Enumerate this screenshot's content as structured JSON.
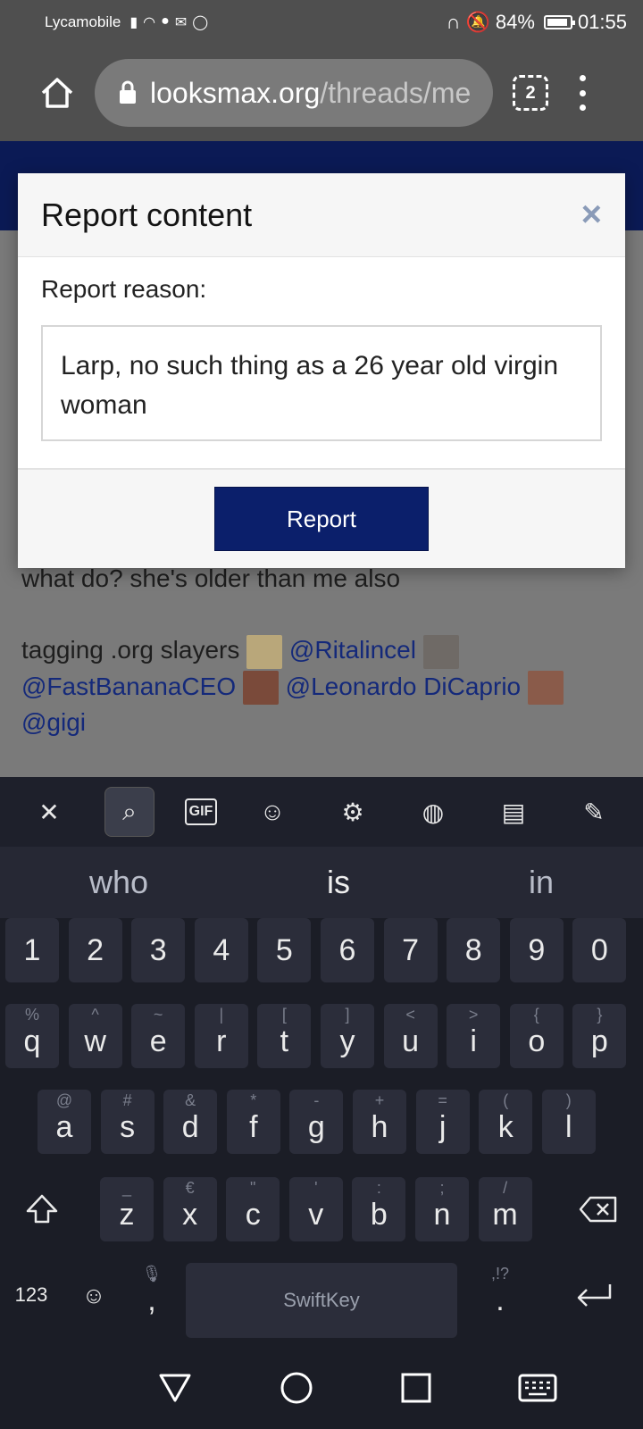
{
  "status_bar": {
    "carrier": "Lycamobile",
    "battery": "84%",
    "time": "01:55"
  },
  "browser": {
    "url_domain": "looksmax.org",
    "url_path": "/threads/me",
    "tab_count": "2"
  },
  "page": {
    "post_line1": "what do? she's older than me also",
    "post_line2": "tagging .org slayers",
    "mentions": [
      "@Ritalincel",
      "@FastBananaCEO",
      "@Leonardo DiCaprio",
      "@gigi"
    ]
  },
  "modal": {
    "title": "Report content",
    "close_label": "×",
    "reason_label": "Report reason:",
    "reason_value": "Larp, no such thing as a 26 year old virgin woman",
    "submit_label": "Report"
  },
  "keyboard": {
    "suggestions": [
      "who",
      "is",
      "in"
    ],
    "number_row": [
      "1",
      "2",
      "3",
      "4",
      "5",
      "6",
      "7",
      "8",
      "9",
      "0"
    ],
    "row1": [
      {
        "k": "q",
        "a": "%"
      },
      {
        "k": "w",
        "a": "^"
      },
      {
        "k": "e",
        "a": "~"
      },
      {
        "k": "r",
        "a": "|"
      },
      {
        "k": "t",
        "a": "["
      },
      {
        "k": "y",
        "a": "]"
      },
      {
        "k": "u",
        "a": "<"
      },
      {
        "k": "i",
        "a": ">"
      },
      {
        "k": "o",
        "a": "{"
      },
      {
        "k": "p",
        "a": "}"
      }
    ],
    "row2": [
      {
        "k": "a",
        "a": "@"
      },
      {
        "k": "s",
        "a": "#"
      },
      {
        "k": "d",
        "a": "&"
      },
      {
        "k": "f",
        "a": "*"
      },
      {
        "k": "g",
        "a": "-"
      },
      {
        "k": "h",
        "a": "+"
      },
      {
        "k": "j",
        "a": "="
      },
      {
        "k": "k",
        "a": "("
      },
      {
        "k": "l",
        "a": ")"
      }
    ],
    "row3": [
      {
        "k": "z",
        "a": "_"
      },
      {
        "k": "x",
        "a": "€"
      },
      {
        "k": "c",
        "a": "\""
      },
      {
        "k": "v",
        "a": "'"
      },
      {
        "k": "b",
        "a": ":"
      },
      {
        "k": "n",
        "a": ";"
      },
      {
        "k": "m",
        "a": "/"
      }
    ],
    "sym_key": "123",
    "comma_key": ",",
    "period_key": ".",
    "period_alt": ",!?",
    "space_brand": "SwiftKey"
  }
}
